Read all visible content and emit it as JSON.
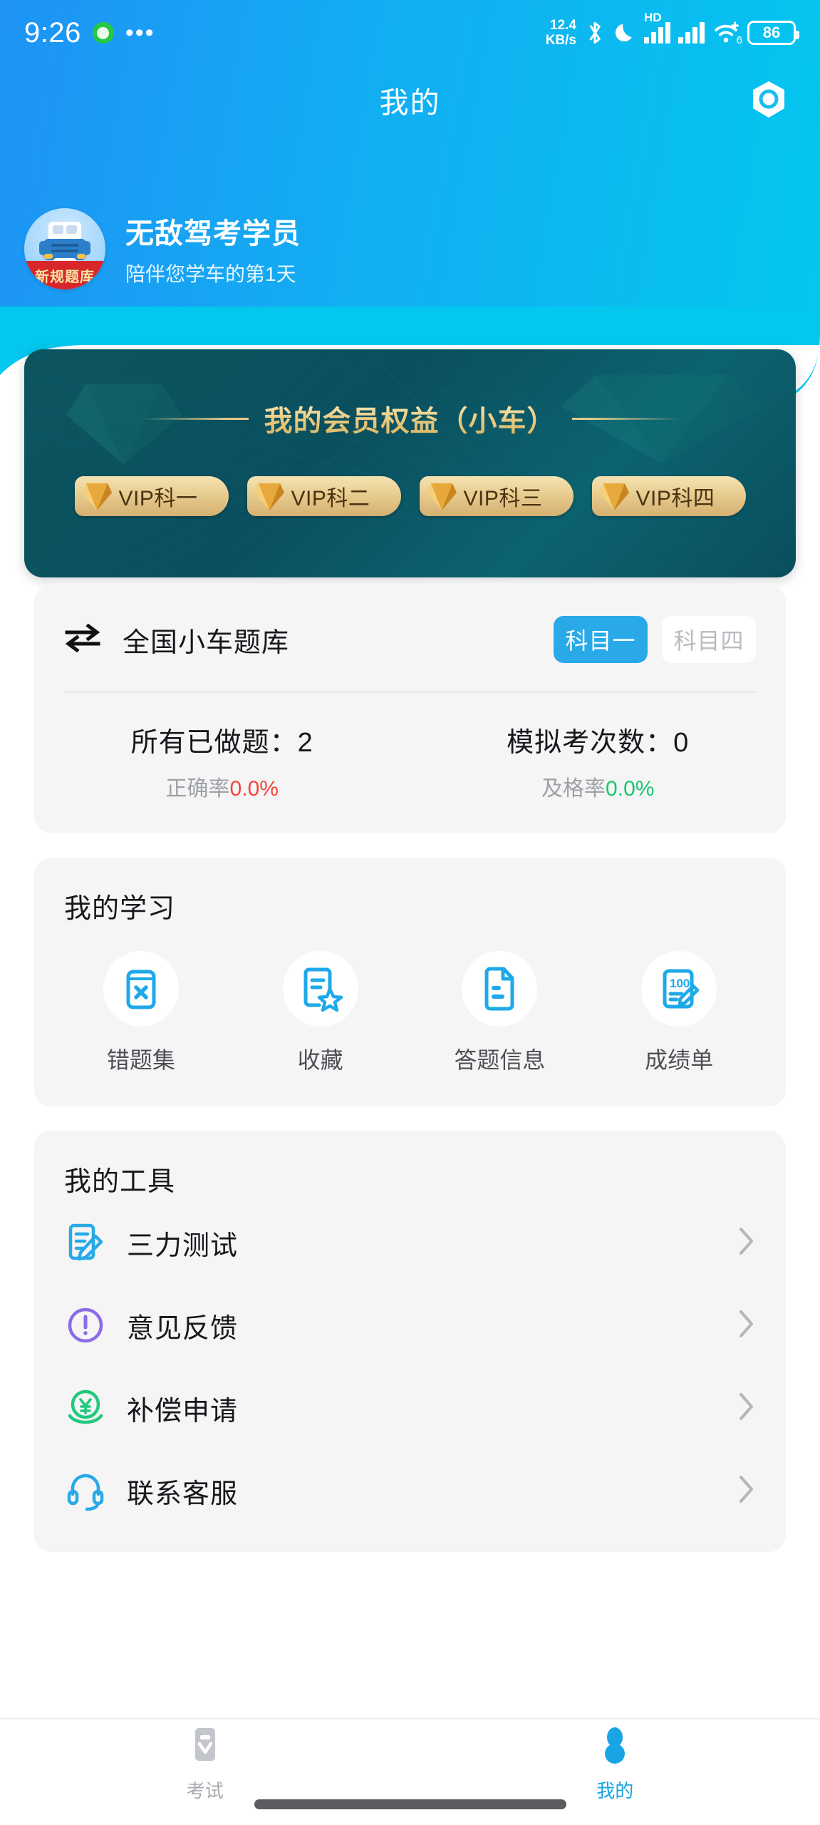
{
  "status_bar": {
    "time": "9:26",
    "ellipsis": "•••",
    "network_speed": "12.4",
    "network_unit": "KB/s",
    "hd_label": "HD",
    "wifi_generation": "6",
    "battery_level": "86",
    "icons": [
      "recording-dot-icon",
      "more-icon",
      "bluetooth-icon",
      "do-not-disturb-moon-icon",
      "hd-icon",
      "signal-bars-icon",
      "signal-bars-icon",
      "wifi-icon",
      "battery-icon"
    ]
  },
  "header": {
    "title": "我的",
    "settings_icon": "gear-hexagon-icon",
    "gradient_from": "#1E93F5",
    "gradient_to": "#03C7EE"
  },
  "profile": {
    "name": "无敌驾考学员",
    "subtitle": "陪伴您学车的第1天",
    "avatar_ribbon": "新规题库",
    "avatar_icon": "car-avatar-icon"
  },
  "vip_card": {
    "title": "我的会员权益（小车）",
    "background_color": "#0A4F5E",
    "gold_color": "#E8C97E",
    "badges": [
      {
        "label": "VIP科一",
        "icon": "diamond-icon"
      },
      {
        "label": "VIP科二",
        "icon": "diamond-icon"
      },
      {
        "label": "VIP科三",
        "icon": "diamond-icon"
      },
      {
        "label": "VIP科四",
        "icon": "diamond-icon"
      }
    ]
  },
  "question_bank": {
    "swap_icon": "swap-arrows-icon",
    "name": "全国小车题库",
    "subject_tabs": [
      {
        "label": "科目一",
        "active": true
      },
      {
        "label": "科目四",
        "active": false
      }
    ],
    "stats": [
      {
        "title": "所有已做题：2",
        "rate_label": "正确率",
        "rate_value": "0.0%",
        "rate_color": "#F4453C"
      },
      {
        "title": "模拟考次数：0",
        "rate_label": "及格率",
        "rate_value": "0.0%",
        "rate_color": "#1BC66A"
      }
    ]
  },
  "study": {
    "section_title": "我的学习",
    "items": [
      {
        "label": "错题集",
        "icon": "wrong-questions-book-icon"
      },
      {
        "label": "收藏",
        "icon": "favorite-star-doc-icon"
      },
      {
        "label": "答题信息",
        "icon": "answer-document-icon"
      },
      {
        "label": "成绩单",
        "icon": "score-report-icon"
      }
    ]
  },
  "tools": {
    "section_title": "我的工具",
    "items": [
      {
        "label": "三力测试",
        "icon": "test-edit-icon",
        "color": "#29A9E8",
        "chevron": "chevron-right-icon"
      },
      {
        "label": "意见反馈",
        "icon": "feedback-exclamation-icon",
        "color": "#8A6BE8",
        "chevron": "chevron-right-icon"
      },
      {
        "label": "补偿申请",
        "icon": "compensation-yuan-icon",
        "color": "#22C97C",
        "chevron": "chevron-right-icon"
      },
      {
        "label": "联系客服",
        "icon": "headset-support-icon",
        "color": "#29A9E8",
        "chevron": "chevron-right-icon"
      }
    ]
  },
  "tab_bar": {
    "tabs": [
      {
        "label": "考试",
        "icon": "exam-clipboard-icon",
        "active": false
      },
      {
        "label": "我的",
        "icon": "profile-person-icon",
        "active": true
      }
    ],
    "active_color": "#19A4E6",
    "inactive_color": "#A6A9AD"
  }
}
